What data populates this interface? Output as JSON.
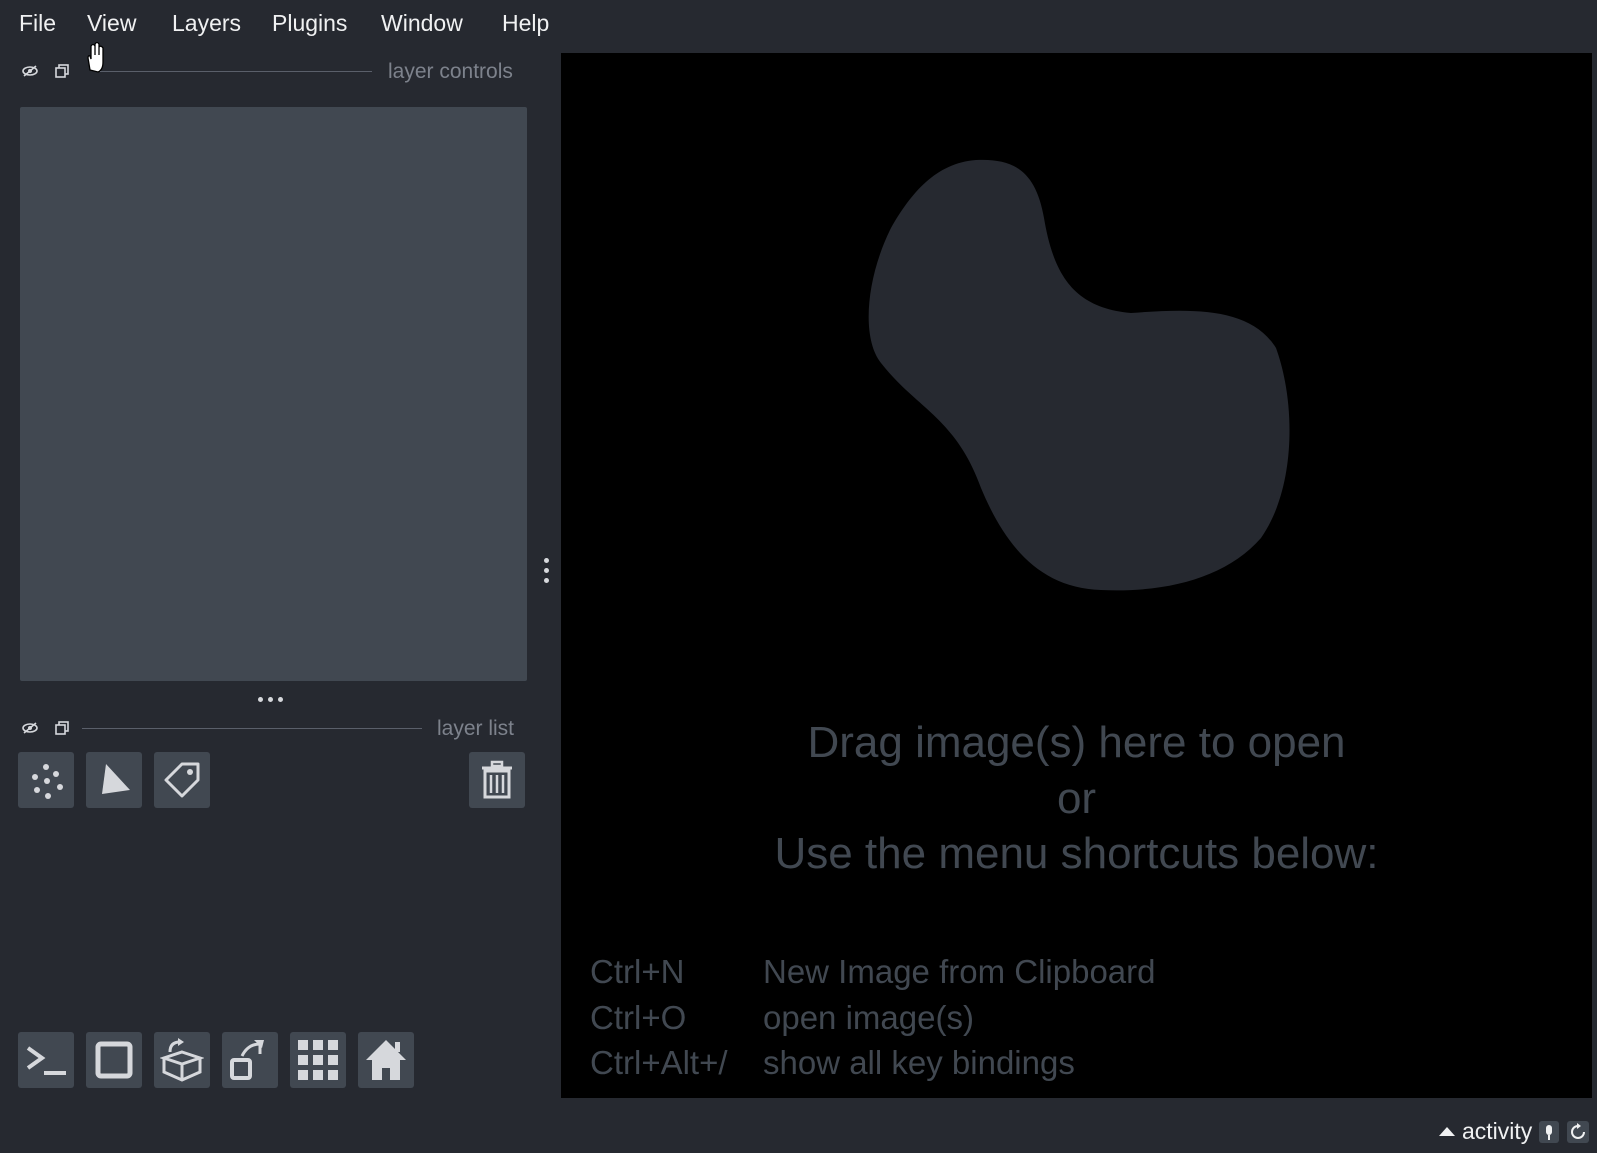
{
  "menu": {
    "file": "File",
    "view": "View",
    "layers": "Layers",
    "plugins": "Plugins",
    "window": "Window",
    "help": "Help"
  },
  "layer_controls": {
    "title": "layer controls"
  },
  "layer_list": {
    "title": "layer list"
  },
  "layer_tools": {
    "new_points": "points-icon",
    "new_shapes": "shapes-icon",
    "new_labels": "labels-icon",
    "delete": "trash-icon"
  },
  "viewer_buttons": [
    "console-icon",
    "square-icon",
    "cube-icon",
    "rotate-icon",
    "grid-icon",
    "home-icon"
  ],
  "welcome": {
    "line1": "Drag image(s) here to open",
    "line2": "or",
    "line3": "Use the menu shortcuts below:",
    "shortcuts": [
      {
        "key": "Ctrl+N",
        "desc": "New Image from Clipboard"
      },
      {
        "key": "Ctrl+O",
        "desc": "open image(s)"
      },
      {
        "key": "Ctrl+Alt+/",
        "desc": "show all key bindings"
      }
    ]
  },
  "status": {
    "activity": "activity"
  },
  "colors": {
    "background": "#262930",
    "panel": "#414851",
    "canvas": "#000000",
    "text": "#f0f1f2",
    "muted": "#414851"
  }
}
